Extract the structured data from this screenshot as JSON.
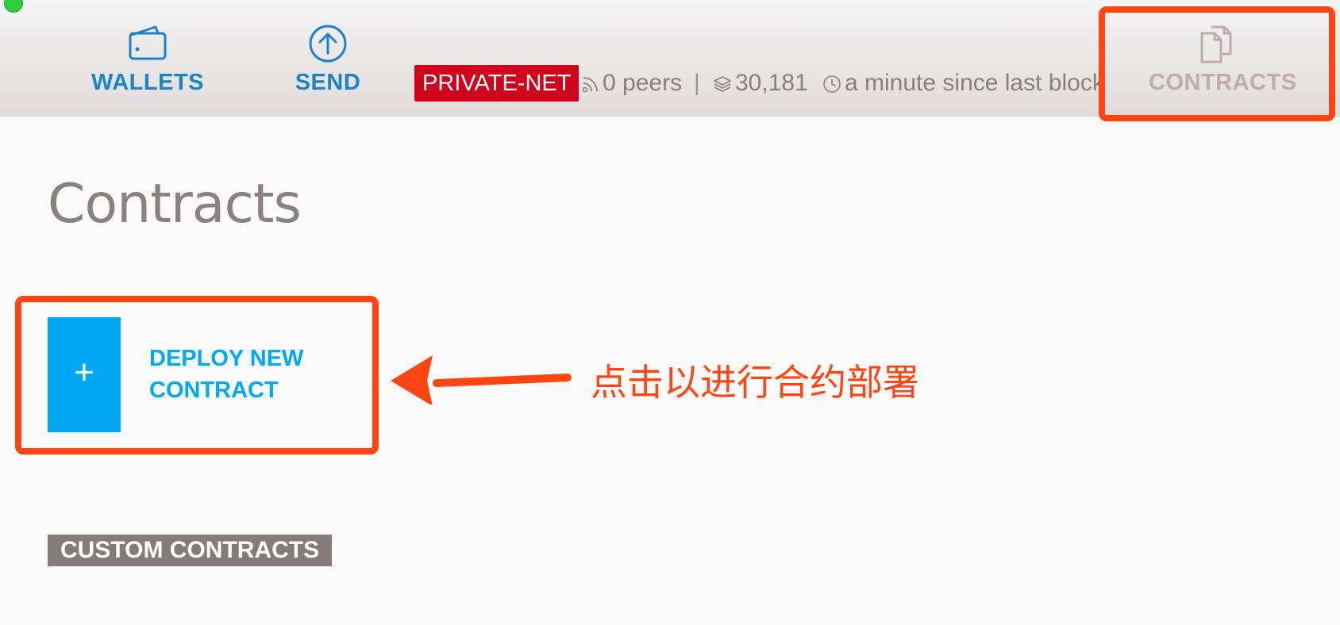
{
  "header": {
    "nav": {
      "wallets": {
        "label": "WALLETS",
        "icon": "wallet-icon"
      },
      "send": {
        "label": "SEND",
        "icon": "arrow-up-circle-icon"
      },
      "contracts": {
        "label": "CONTRACTS",
        "icon": "documents-icon",
        "active": true
      }
    },
    "network_badge": "PRIVATE-NET",
    "peers": "0 peers",
    "separator": "|",
    "blocks": "30,181",
    "last_block": "a minute since last block"
  },
  "main": {
    "title": "Contracts",
    "deploy_label": "DEPLOY NEW CONTRACT",
    "deploy_icon": "+",
    "custom_section_label": "CUSTOM CONTRACTS"
  },
  "annotation": {
    "callout": "点击以进行合约部署"
  },
  "colors": {
    "accent_blue": "#02a8f3",
    "nav_blue": "#1c84c4",
    "badge_red": "#d0021b",
    "annotation_orange": "#ff4512",
    "section_tag_bg": "#857b7b"
  }
}
